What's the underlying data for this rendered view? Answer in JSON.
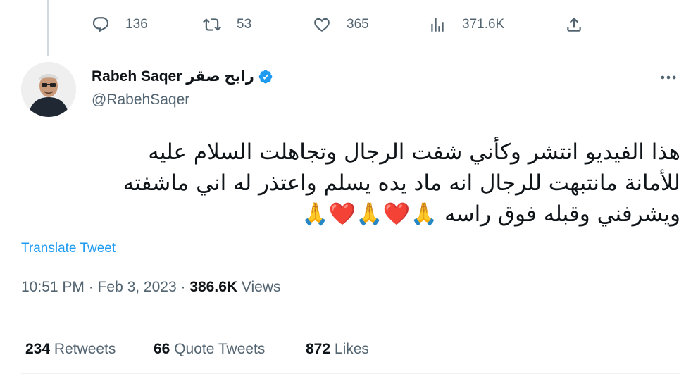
{
  "previous_tweet": {
    "actions": {
      "replies": "136",
      "retweets": "53",
      "likes": "365",
      "views": "371.6K"
    }
  },
  "tweet": {
    "author": {
      "display_name": "Rabeh Saqer رابح صقر",
      "handle": "@RabehSaqer"
    },
    "text_lines": [
      "هذا الفيديو انتشر وكأني شفت الرجال وتجاهلت السلام عليه",
      "للأمانة مانتبهت للرجال انه ماد يده يسلم واعتذر له اني ماشفته",
      "ويشرفني وقبله فوق  راسه 🙏❤️🙏❤️🙏"
    ],
    "translate_label": "Translate Tweet",
    "time": "10:51 PM",
    "date": "Feb 3, 2023",
    "views_count": "386.6K",
    "views_label": "Views"
  },
  "stats": {
    "retweets_count": "234",
    "retweets_label": "Retweets",
    "quotes_count": "66",
    "quotes_label": "Quote Tweets",
    "likes_count": "872",
    "likes_label": "Likes"
  },
  "colors": {
    "accent": "#1d9bf0",
    "secondary_text": "#536471",
    "primary_text": "#0f1419"
  }
}
